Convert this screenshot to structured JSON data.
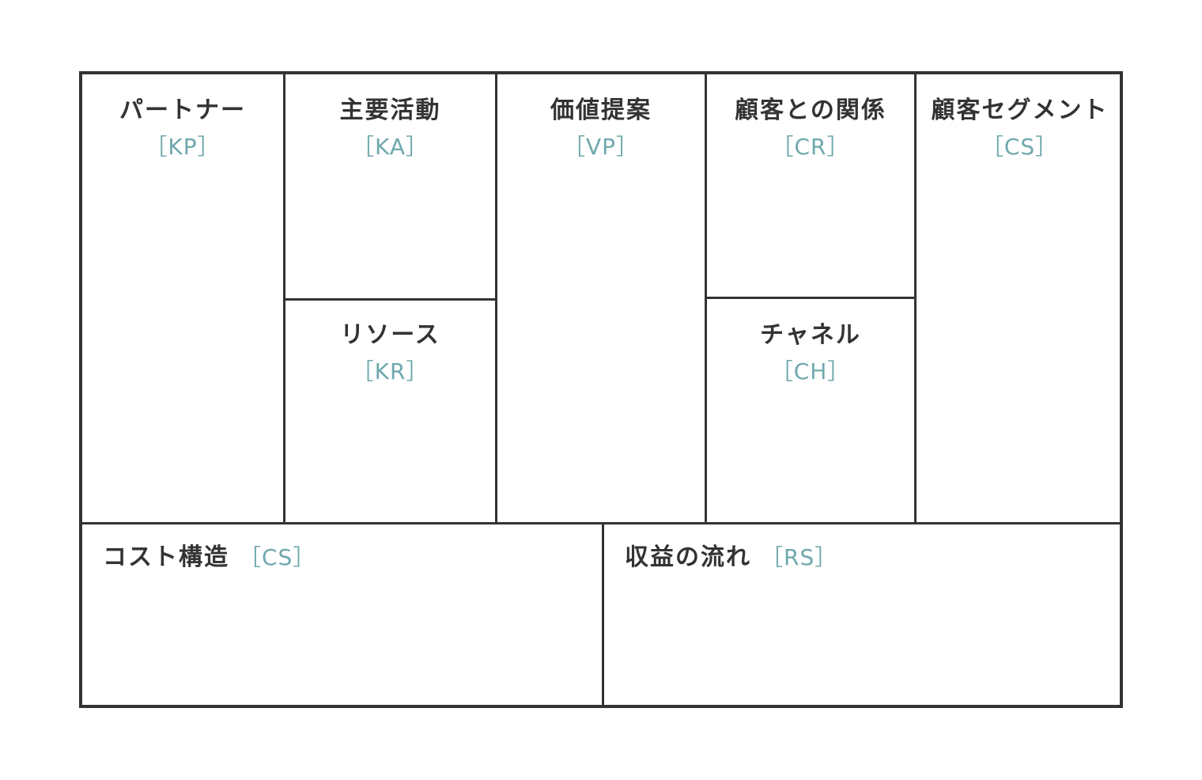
{
  "canvas": {
    "blocks": {
      "kp": {
        "label": "パートナー",
        "code": "［KP］"
      },
      "ka": {
        "label": "主要活動",
        "code": "［KA］"
      },
      "kr": {
        "label": "リソース",
        "code": "［KR］"
      },
      "vp": {
        "label": "価値提案",
        "code": "［VP］"
      },
      "cr": {
        "label": "顧客との関係",
        "code": "［CR］"
      },
      "ch": {
        "label": "チャネル",
        "code": "［CH］"
      },
      "cs": {
        "label": "顧客セグメント",
        "code": "［CS］"
      },
      "cost": {
        "label": "コスト構造",
        "code": "［CS］"
      },
      "rs": {
        "label": "収益の流れ",
        "code": "［RS］"
      }
    }
  },
  "colors": {
    "border": "#333333",
    "label": "#333333",
    "code": "#6fa8ad",
    "background": "#ffffff"
  }
}
